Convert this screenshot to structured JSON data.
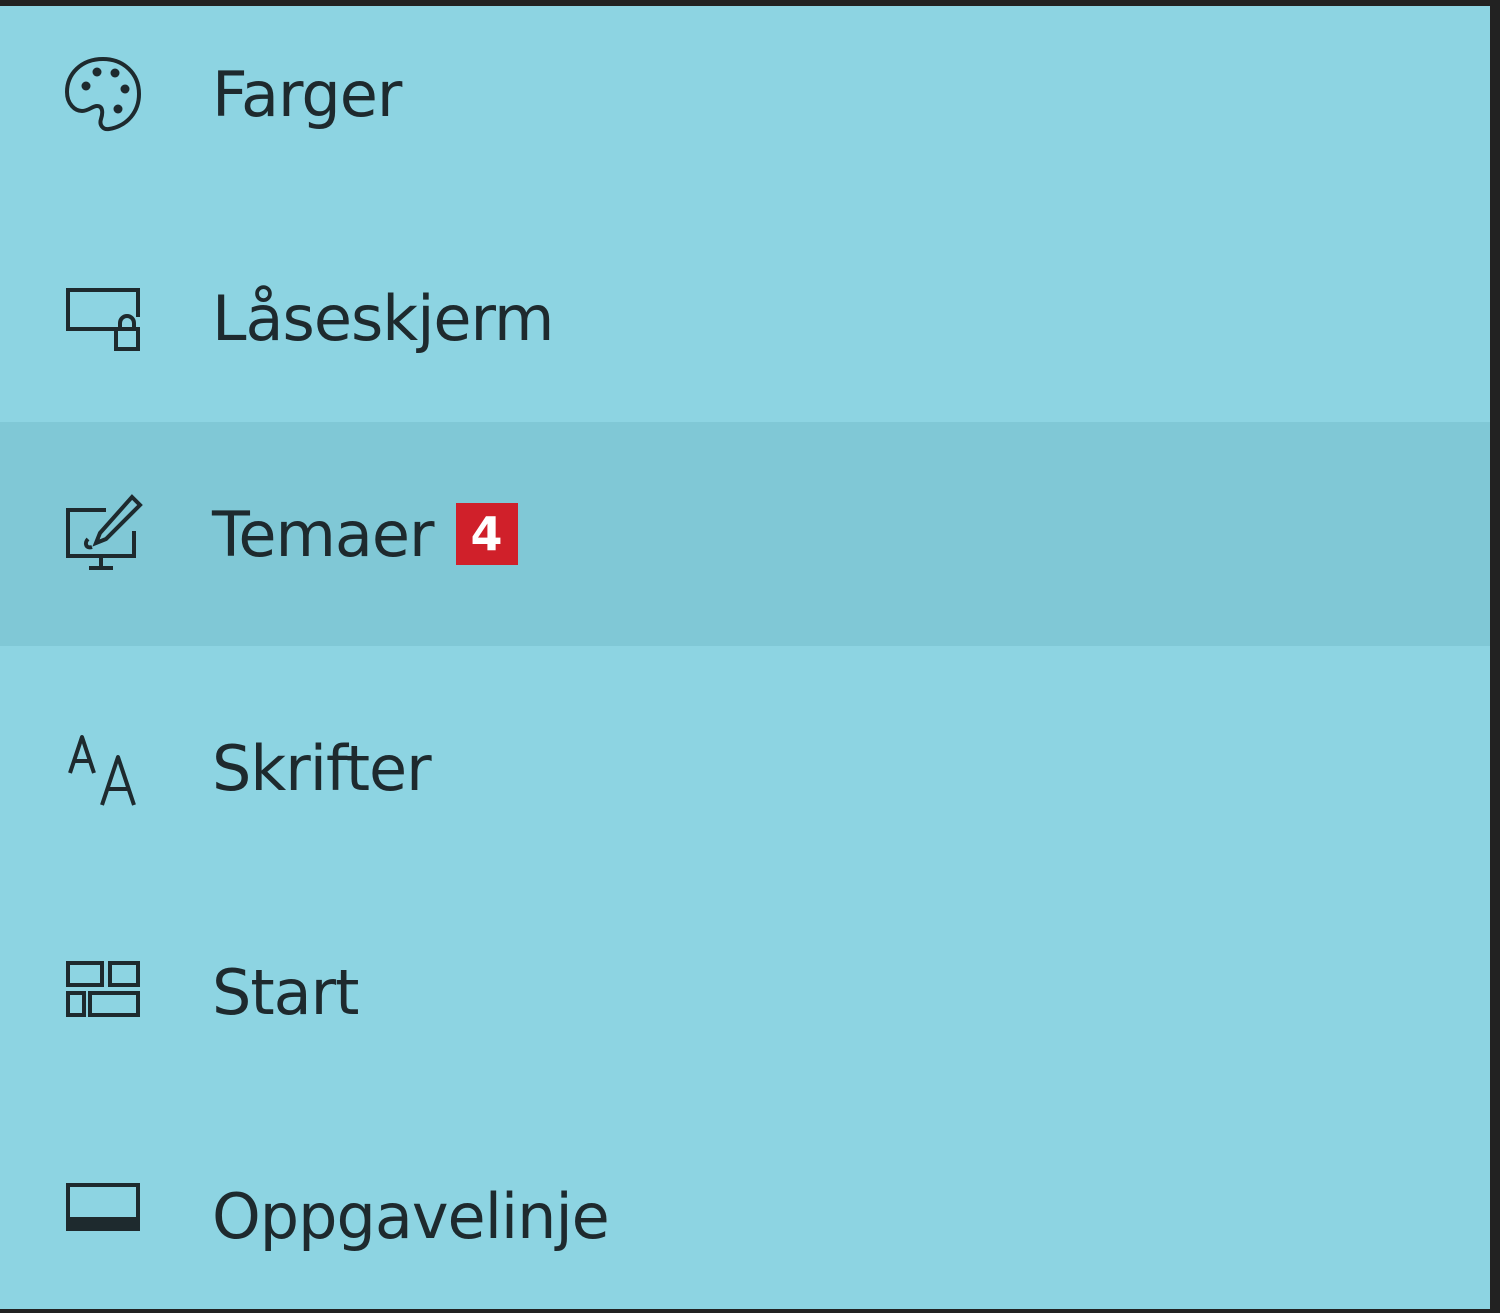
{
  "colors": {
    "background": "#8dd4e2",
    "selected_background": "#80c8d6",
    "text": "#1e2a2e",
    "badge_background": "#d0202a",
    "badge_text": "#ffffff"
  },
  "nav": {
    "items": [
      {
        "label": "Farger",
        "icon": "palette-icon"
      },
      {
        "label": "Låseskjerm",
        "icon": "lock-screen-icon"
      },
      {
        "label": "Temaer",
        "icon": "themes-icon",
        "badge": "4",
        "selected": true
      },
      {
        "label": "Skrifter",
        "icon": "fonts-icon"
      },
      {
        "label": "Start",
        "icon": "start-icon"
      },
      {
        "label": "Oppgavelinje",
        "icon": "taskbar-icon"
      }
    ]
  }
}
